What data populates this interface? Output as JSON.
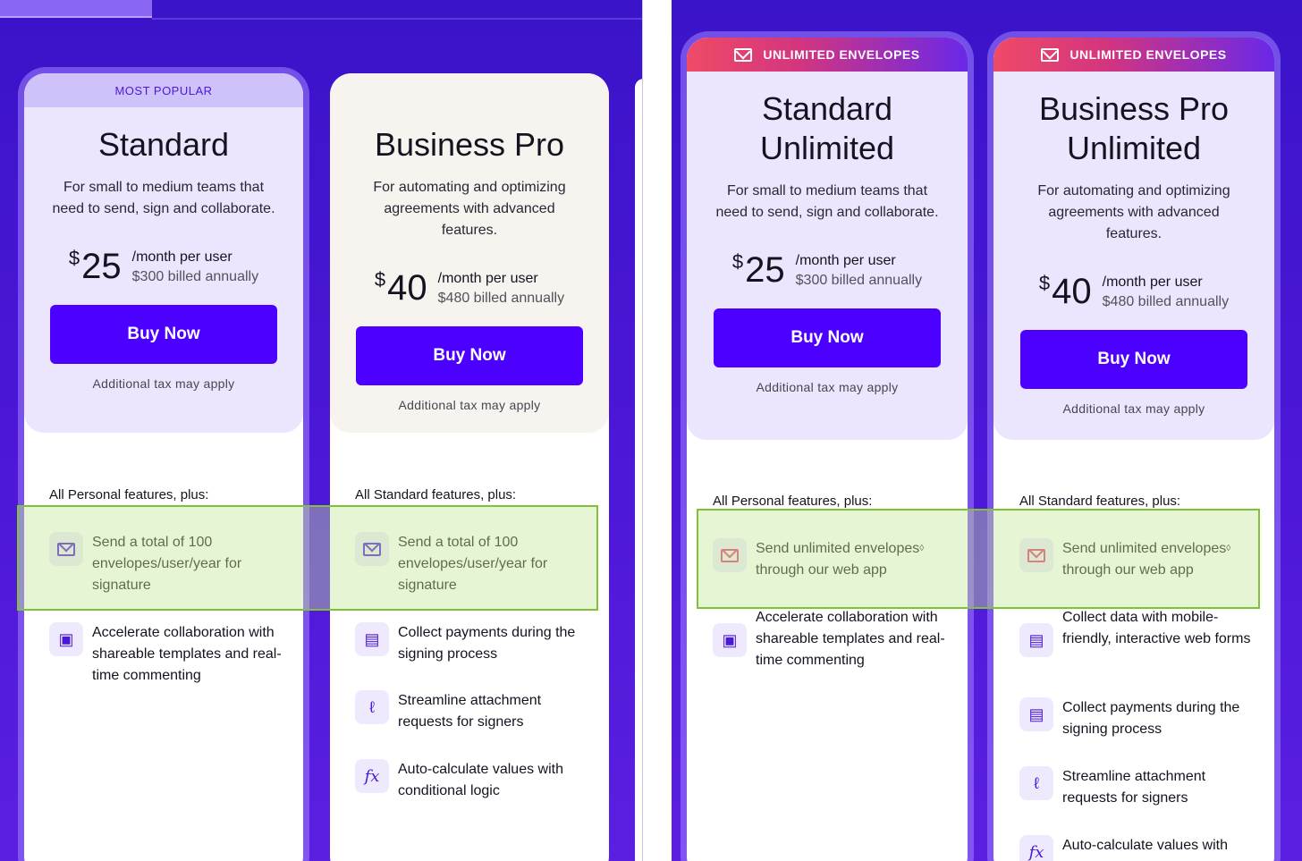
{
  "left_panel": {
    "cards": [
      {
        "banner": "MOST POPULAR",
        "title": "Standard",
        "description": "For small to medium teams that need to send, sign and collaborate.",
        "currency": "$",
        "price": "25",
        "per": "/month per user",
        "billed": "$300 billed annually",
        "buy_label": "Buy Now",
        "tax": "Additional tax may apply",
        "intro": "All Personal features, plus:",
        "features": [
          {
            "icon": "envelope-icon",
            "text": "Send a total of 100 envelopes/user/year for signature"
          },
          {
            "icon": "comment-icon",
            "text": "Accelerate collaboration with shareable templates and real-time commenting"
          }
        ]
      },
      {
        "title": "Business Pro",
        "description": "For automating and optimizing agreements with advanced features.",
        "currency": "$",
        "price": "40",
        "per": "/month per user",
        "billed": "$480 billed annually",
        "buy_label": "Buy Now",
        "tax": "Additional tax may apply",
        "intro": "All Standard features, plus:",
        "features": [
          {
            "icon": "envelope-icon",
            "text": "Send a total of 100 envelopes/user/year for signature"
          },
          {
            "icon": "credit-card-icon",
            "text": "Collect payments during the signing process"
          },
          {
            "icon": "paperclip-icon",
            "text": "Streamline attachment requests for signers"
          },
          {
            "icon": "function-icon",
            "text": "Auto-calculate values with conditional logic"
          }
        ]
      }
    ]
  },
  "right_panel": {
    "cards": [
      {
        "banner": "UNLIMITED ENVELOPES",
        "title_line1": "Standard",
        "title_line2": "Unlimited",
        "description": "For small to medium teams that need to send, sign and collaborate.",
        "currency": "$",
        "price": "25",
        "per": "/month per user",
        "billed": "$300 billed annually",
        "buy_label": "Buy Now",
        "tax": "Additional tax may apply",
        "intro": "All Personal features, plus:",
        "features": [
          {
            "icon": "envelope-icon",
            "text": "Send unlimited envelopes",
            "sup": "◊",
            "text2": "through our web app"
          },
          {
            "icon": "comment-icon",
            "text": "Accelerate collaboration with shareable templates and real-time commenting"
          }
        ]
      },
      {
        "banner": "UNLIMITED ENVELOPES",
        "title_line1": "Business Pro",
        "title_line2": "Unlimited",
        "description": "For automating and optimizing agreements with advanced features.",
        "currency": "$",
        "price": "40",
        "per": "/month per user",
        "billed": "$480 billed annually",
        "buy_label": "Buy Now",
        "tax": "Additional tax may apply",
        "intro": "All Standard features, plus:",
        "features": [
          {
            "icon": "envelope-icon",
            "text": "Send unlimited envelopes",
            "sup": "◊",
            "text2": "through our web app"
          },
          {
            "icon": "form-icon",
            "text": "Collect data with mobile-friendly, interactive web forms"
          },
          {
            "icon": "credit-card-icon",
            "text": "Collect payments during the signing process"
          },
          {
            "icon": "paperclip-icon",
            "text": "Streamline attachment requests for signers"
          },
          {
            "icon": "function-icon",
            "text": "Auto-calculate values with"
          }
        ]
      }
    ]
  },
  "colors": {
    "background": "#4a16d6",
    "primary_button": "#4c00ff",
    "highlight_border": "#7fc236",
    "banner_gradient_start": "#ef4a67"
  }
}
